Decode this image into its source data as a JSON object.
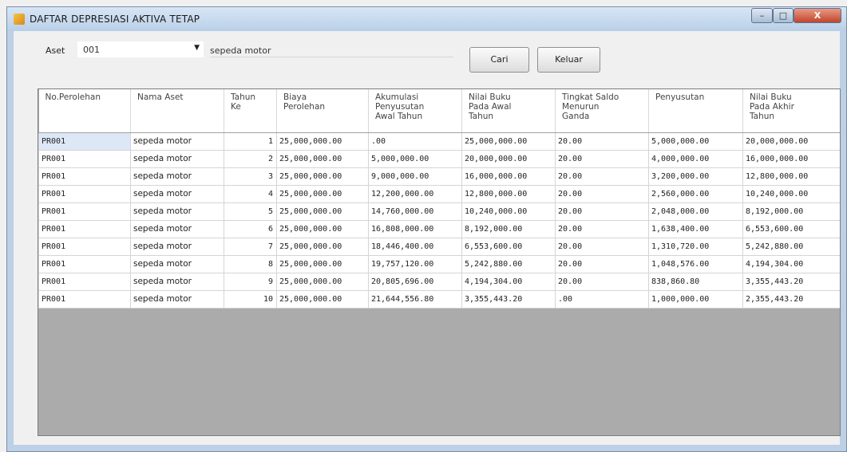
{
  "window": {
    "title": "DAFTAR DEPRESIASI AKTIVA TETAP",
    "close_glyph": "X"
  },
  "filter": {
    "aset_label": "Aset",
    "aset_value": "001",
    "asset_name": "sepeda motor"
  },
  "buttons": {
    "cari": "Cari",
    "keluar": "Keluar"
  },
  "table": {
    "headers": [
      "No.Perolehan",
      "Nama Aset",
      "Tahun\nKe",
      "Biaya\nPerolehan",
      "Akumulasi\nPenyusutan\nAwal Tahun",
      "Nilai Buku\nPada Awal\nTahun",
      "Tingkat Saldo\nMenurun\nGanda",
      "Penyusutan",
      "Nilai Buku\nPada Akhir\nTahun"
    ],
    "rows": [
      [
        "PR001",
        "sepeda motor",
        "1",
        "25,000,000.00",
        ".00",
        "25,000,000.00",
        "20.00",
        "5,000,000.00",
        "20,000,000.00"
      ],
      [
        "PR001",
        "sepeda motor",
        "2",
        "25,000,000.00",
        "5,000,000.00",
        "20,000,000.00",
        "20.00",
        "4,000,000.00",
        "16,000,000.00"
      ],
      [
        "PR001",
        "sepeda motor",
        "3",
        "25,000,000.00",
        "9,000,000.00",
        "16,000,000.00",
        "20.00",
        "3,200,000.00",
        "12,800,000.00"
      ],
      [
        "PR001",
        "sepeda motor",
        "4",
        "25,000,000.00",
        "12,200,000.00",
        "12,800,000.00",
        "20.00",
        "2,560,000.00",
        "10,240,000.00"
      ],
      [
        "PR001",
        "sepeda motor",
        "5",
        "25,000,000.00",
        "14,760,000.00",
        "10,240,000.00",
        "20.00",
        "2,048,000.00",
        "8,192,000.00"
      ],
      [
        "PR001",
        "sepeda motor",
        "6",
        "25,000,000.00",
        "16,808,000.00",
        "8,192,000.00",
        "20.00",
        "1,638,400.00",
        "6,553,600.00"
      ],
      [
        "PR001",
        "sepeda motor",
        "7",
        "25,000,000.00",
        "18,446,400.00",
        "6,553,600.00",
        "20.00",
        "1,310,720.00",
        "5,242,880.00"
      ],
      [
        "PR001",
        "sepeda motor",
        "8",
        "25,000,000.00",
        "19,757,120.00",
        "5,242,880.00",
        "20.00",
        "1,048,576.00",
        "4,194,304.00"
      ],
      [
        "PR001",
        "sepeda motor",
        "9",
        "25,000,000.00",
        "20,805,696.00",
        "4,194,304.00",
        "20.00",
        "838,860.80",
        "3,355,443.20"
      ],
      [
        "PR001",
        "sepeda motor",
        "10",
        "25,000,000.00",
        "21,644,556.80",
        "3,355,443.20",
        ".00",
        "1,000,000.00",
        "2,355,443.20"
      ]
    ]
  }
}
